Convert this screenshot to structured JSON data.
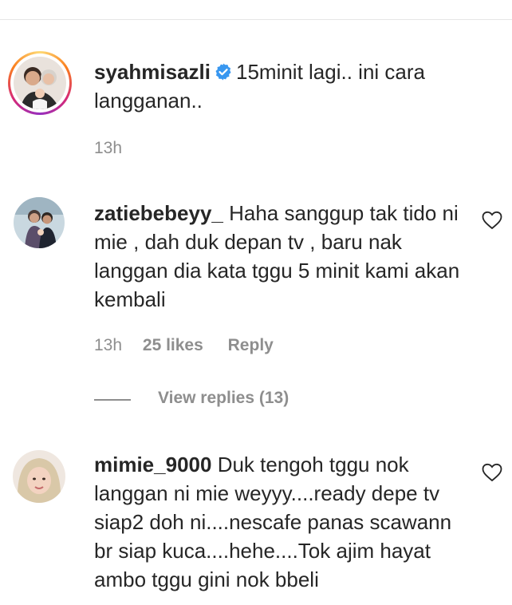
{
  "comments": [
    {
      "username": "syahmisazli",
      "verified": true,
      "text": "15minit lagi.. ini cara langganan..",
      "time": "13h"
    },
    {
      "username": "zatiebebeyy_",
      "text": "Haha sanggup tak tido ni mie , dah duk depan tv , baru nak langgan dia kata tggu 5 minit kami akan kembali",
      "time": "13h",
      "likes": "25 likes",
      "reply_label": "Reply",
      "view_replies": "View replies (13)"
    },
    {
      "username": "mimie_9000",
      "text": "Duk tengoh tggu nok langgan ni mie weyyy....ready depe tv siap2 doh ni....nescafe panas scawann br siap kuca....hehe....Tok ajim hayat ambo tggu gini nok bbeli"
    }
  ],
  "icons": {
    "verified": "verified-badge-icon",
    "like": "heart-outline-icon"
  },
  "colors": {
    "verified_blue": "#3897f0",
    "meta_gray": "#8e8e8e",
    "text": "#262626"
  }
}
